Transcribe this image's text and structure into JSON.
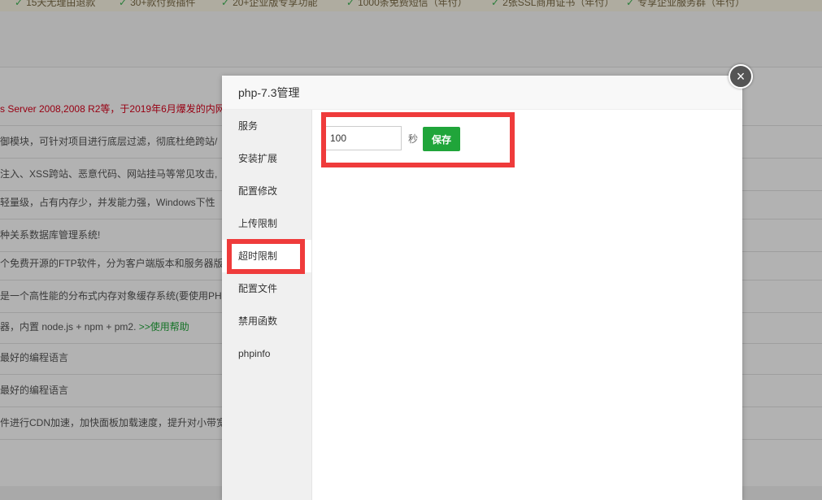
{
  "features": [
    "15天无理由退款",
    "30+款付费插件",
    "20+企业版专享功能",
    "1000条免费短信（年付）",
    "2张SSL商用证书（年付）",
    "专享企业服务群（年付）"
  ],
  "background_rows": [
    {
      "text": "s Server 2008,2008 R2等，于2019年6月爆发的内网",
      "extra": ""
    },
    {
      "text": "御模块，可针对项目进行底层过滤，彻底杜绝跨站/",
      "extra": ""
    },
    {
      "text": "注入、XSS跨站、恶意代码、网站挂马等常见攻击,",
      "extra": ""
    },
    {
      "text": "轻量级，占有内存少，并发能力强，Windows下性",
      "extra": ""
    },
    {
      "text": "种关系数据库管理系统!",
      "extra": ""
    },
    {
      "text": "个免费开源的FTP软件，分为客户端版本和服务器版本",
      "extra": ""
    },
    {
      "text": "是一个高性能的分布式内存对象缓存系统(要使用PH",
      "extra": ""
    },
    {
      "text": "器，内置 node.js + npm + pm2. ",
      "extra": ">>使用帮助"
    },
    {
      "text": "最好的编程语言",
      "extra": ""
    },
    {
      "text": "最好的编程语言",
      "extra": ""
    },
    {
      "text": "件进行CDN加速，加快面板加载速度，提升对小带宽",
      "extra": ""
    }
  ],
  "dialog": {
    "title": "php-7.3管理",
    "close_symbol": "×",
    "nav": [
      "服务",
      "安装扩展",
      "配置修改",
      "上传限制",
      "超时限制",
      "配置文件",
      "禁用函数",
      "phpinfo"
    ],
    "active_nav_index": 4,
    "timeout": {
      "value": "100",
      "unit": "秒",
      "save_label": "保存"
    }
  },
  "colors": {
    "accent_green": "#20a53a",
    "highlight_red": "#ef3b3b",
    "notice_red": "#d9001b"
  },
  "icons": {
    "check": "check-icon",
    "close": "close-icon"
  }
}
